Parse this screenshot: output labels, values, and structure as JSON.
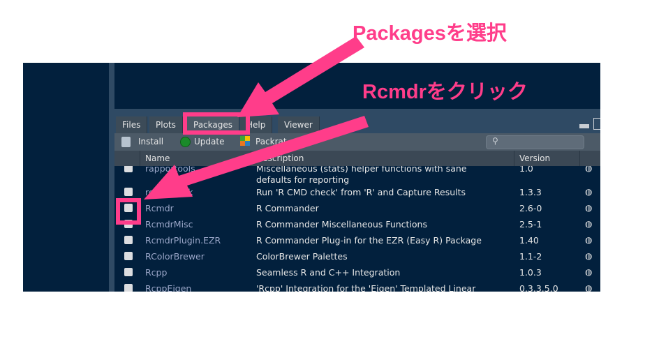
{
  "annotations": {
    "step1": "Packagesを選択",
    "step2": "Rcmdrをクリック",
    "color": "#ff3d8a"
  },
  "tabs": [
    "Files",
    "Plots",
    "Packages",
    "Help",
    "Viewer"
  ],
  "toolbar": {
    "install": "Install",
    "update": "Update",
    "packrat": "Packrat"
  },
  "columns": {
    "name": "Name",
    "description": "Description",
    "version": "Version"
  },
  "rows": [
    {
      "name": "rapportools",
      "description": "Miscellaneous (stats) helper functions with sane",
      "description2": "defaults for reporting",
      "version": "1.0"
    },
    {
      "name": "rcmdcheck",
      "description": "Run 'R CMD check' from 'R' and Capture Results",
      "version": "1.3.3"
    },
    {
      "name": "Rcmdr",
      "description": "R Commander",
      "version": "2.6-0"
    },
    {
      "name": "RcmdrMisc",
      "description": "R Commander Miscellaneous Functions",
      "version": "2.5-1"
    },
    {
      "name": "RcmdrPlugin.EZR",
      "description": "R Commander Plug-in for the EZR (Easy R) Package",
      "version": "1.40"
    },
    {
      "name": "RColorBrewer",
      "description": "ColorBrewer Palettes",
      "version": "1.1-2"
    },
    {
      "name": "Rcpp",
      "description": "Seamless R and C++ Integration",
      "version": "1.0.3"
    },
    {
      "name": "RcppEigen",
      "description": "'Rcpp' Integration for the 'Eigen' Templated Linear",
      "version": "0.3.3.5.0"
    }
  ]
}
